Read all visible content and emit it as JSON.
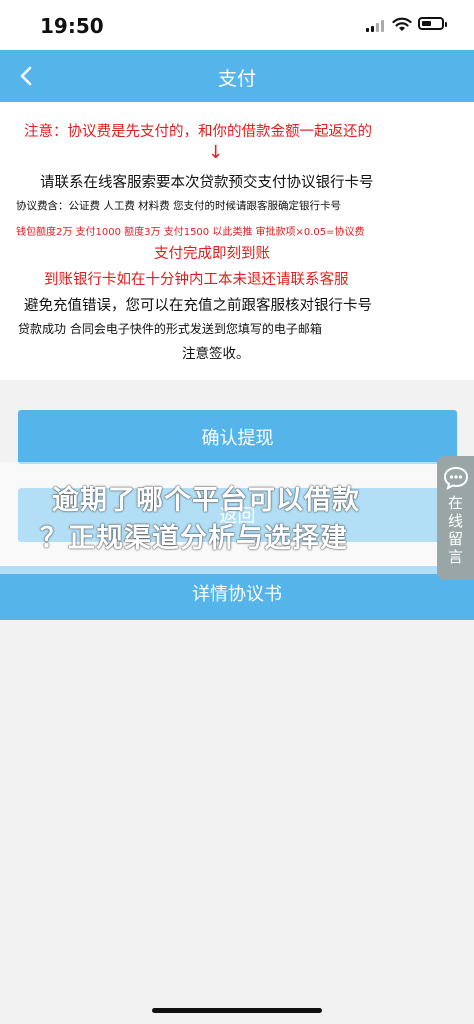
{
  "status_bar": {
    "time": "19:50"
  },
  "nav": {
    "title": "支付"
  },
  "notice": {
    "line1": "注意：协议费是先支付的，和你的借款金额一起返还的",
    "arrow": "↓",
    "line2": "请联系在线客服索要本次贷款预交支付协议银行卡号",
    "line3": "协议费含：公证费 人工费 材料费 您支付的时候请跟客服确定银行卡号",
    "line4": "钱包额度2万 支付1000  额度3万 支付1500 以此类推 审批款项×0.05=协议费",
    "line5": "支付完成即刻到账",
    "line6": "到账银行卡如在十分钟内工本未退还请联系客服",
    "line7": "避免充值错误，您可以在充值之前跟客服核对银行卡号",
    "line8": "贷款成功 合同会电子快件的形式发送到您填写的电子邮箱",
    "line9": "注意签收。"
  },
  "buttons": {
    "confirm": "确认提现",
    "back": "返回",
    "agreement": "详情协议书"
  },
  "banner": {
    "line1": "逾期了哪个平台可以借款",
    "line2": "？正规渠道分析与选择建"
  },
  "side_widget": {
    "label": "在线留言",
    "icon": "chat-bubble-icon"
  },
  "colors": {
    "accent": "#55b5ea",
    "warning": "#e02020"
  }
}
